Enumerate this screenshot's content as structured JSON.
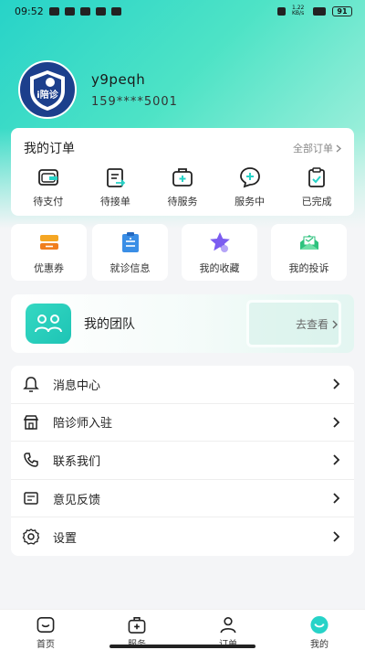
{
  "status_bar": {
    "time": "09:52",
    "network": "1.22 KB/s",
    "battery": "91"
  },
  "profile": {
    "username": "y9peqh",
    "phone": "159****5001",
    "avatar_logo": "i陪诊"
  },
  "orders": {
    "title": "我的订单",
    "view_all": "全部订单",
    "items": [
      {
        "label": "待支付",
        "icon": "wallet-icon"
      },
      {
        "label": "待接单",
        "icon": "order-receive-icon"
      },
      {
        "label": "待服务",
        "icon": "medical-kit-icon"
      },
      {
        "label": "服务中",
        "icon": "chat-plus-icon"
      },
      {
        "label": "已完成",
        "icon": "clipboard-check-icon"
      }
    ]
  },
  "quick_links": [
    {
      "label": "优惠券",
      "icon": "coupon-icon",
      "color": "#f5a623"
    },
    {
      "label": "就诊信息",
      "icon": "medical-record-icon",
      "color": "#3a8ee6"
    },
    {
      "label": "我的收藏",
      "icon": "star-icon",
      "color": "#7b5cf0"
    },
    {
      "label": "我的投诉",
      "icon": "complaint-icon",
      "color": "#2ec27e"
    }
  ],
  "team": {
    "label": "我的团队",
    "link": "去查看"
  },
  "menu": [
    {
      "label": "消息中心",
      "icon": "bell-icon"
    },
    {
      "label": "陪诊师入驻",
      "icon": "store-icon"
    },
    {
      "label": "联系我们",
      "icon": "phone-icon"
    },
    {
      "label": "意见反馈",
      "icon": "feedback-icon"
    },
    {
      "label": "设置",
      "icon": "gear-icon"
    }
  ],
  "tabbar": [
    {
      "label": "首页",
      "icon": "home-icon"
    },
    {
      "label": "服务",
      "icon": "service-icon"
    },
    {
      "label": "订单",
      "icon": "order-person-icon"
    },
    {
      "label": "我的",
      "icon": "profile-icon",
      "active": true
    }
  ],
  "colors": {
    "accent": "#27d3c8",
    "accent_dark": "#1ec4b5",
    "text": "#222222",
    "muted": "#888888"
  }
}
